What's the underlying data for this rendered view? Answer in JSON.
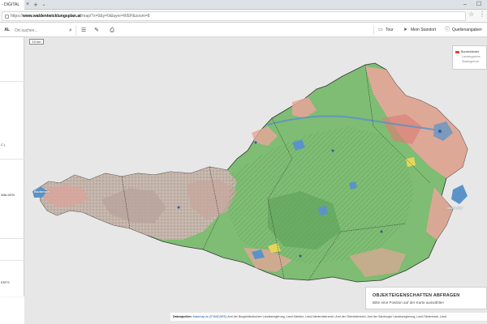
{
  "browser": {
    "tab_title": "- DIGITAL",
    "tab_close": "×",
    "new_tab": "+",
    "tab_menu": "⌄",
    "window": {
      "minimize": "–",
      "maximize": "☐"
    },
    "url_prefix": "https://",
    "url_host": "www.waldentwicklungsplan.at",
    "url_path": "/map/?x=0&y=0&layer=WEP&zoom=8"
  },
  "app": {
    "brand": "AL",
    "search_placeholder": "Ort suchen...",
    "toolbar": {
      "tour": "Tour",
      "location": "Mein Standort",
      "sources": "Quellenangaben"
    }
  },
  "left_panel": {
    "line_a": "C )",
    "line_b": "WALDEN",
    "line_c": "ENTS"
  },
  "map": {
    "scale": "10 km",
    "legend": {
      "title": "Bundesländer",
      "row2": "Landesgrenze",
      "row3": "Staatsgrenze"
    },
    "labels": {
      "bodensee": "Bodensee",
      "neusiedl": "Neusiedler"
    },
    "colors": {
      "background": "#e7e7e7",
      "forest": "#7ebd73",
      "forest_dark": "#5b9f57",
      "protection": "#e9a59a",
      "alpine": "#c8b3ac",
      "water": "#5b93c9",
      "grid": "#333333"
    }
  },
  "object_panel": {
    "title": "OBJEKTEIGENSCHAFTEN ABFRAGEN",
    "subtitle": "Bitte eine Position auf der Karte auswählen"
  },
  "attribution": {
    "label": "Datenquellen:",
    "basemap": "basemap.at (STANDARD)",
    "text": "Amt der Burgenländischen Landesregierung, Land Kärnten, Land Niederösterreich, Amt der Oberösterreich, Amt der Salzburger Landesregierung, Land Steiermark, Land"
  }
}
